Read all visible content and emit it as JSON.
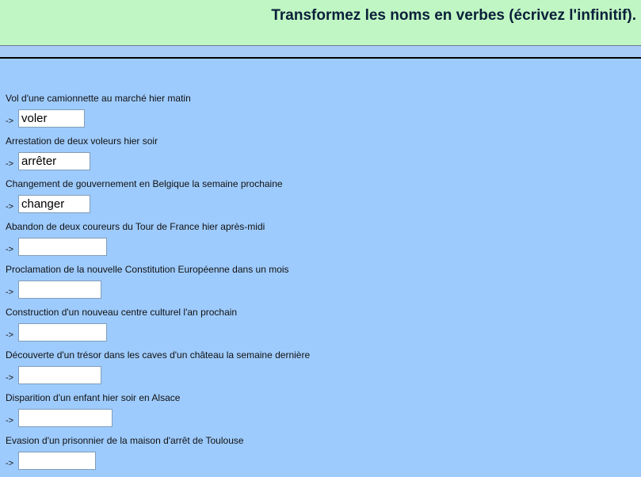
{
  "header": {
    "title": "Transformez les noms en verbes (écrivez l'infinitif)."
  },
  "exercise": {
    "arrow": "->",
    "items": [
      {
        "prompt": "Vol d'une camionnette au marché hier matin",
        "value": "voler"
      },
      {
        "prompt": "Arrestation de deux voleurs hier soir",
        "value": "arrêter"
      },
      {
        "prompt": "Changement de gouvernement en Belgique la semaine prochaine",
        "value": "changer"
      },
      {
        "prompt": "Abandon de deux coureurs du Tour de France hier après-midi",
        "value": ""
      },
      {
        "prompt": "Proclamation de la nouvelle Constitution Européenne dans un mois",
        "value": ""
      },
      {
        "prompt": "Construction d'un nouveau centre culturel l'an prochain",
        "value": ""
      },
      {
        "prompt": "Découverte d'un trésor dans les caves d'un château la semaine dernière",
        "value": ""
      },
      {
        "prompt": "Disparition d'un enfant hier soir en Alsace",
        "value": ""
      },
      {
        "prompt": "Evasion d'un prisonnier de la maison d'arrêt de Toulouse",
        "value": ""
      }
    ]
  },
  "colors": {
    "header_bg": "#c0f6c3",
    "main_bg": "#9ecbfd",
    "input_border": "#7f9db9"
  }
}
